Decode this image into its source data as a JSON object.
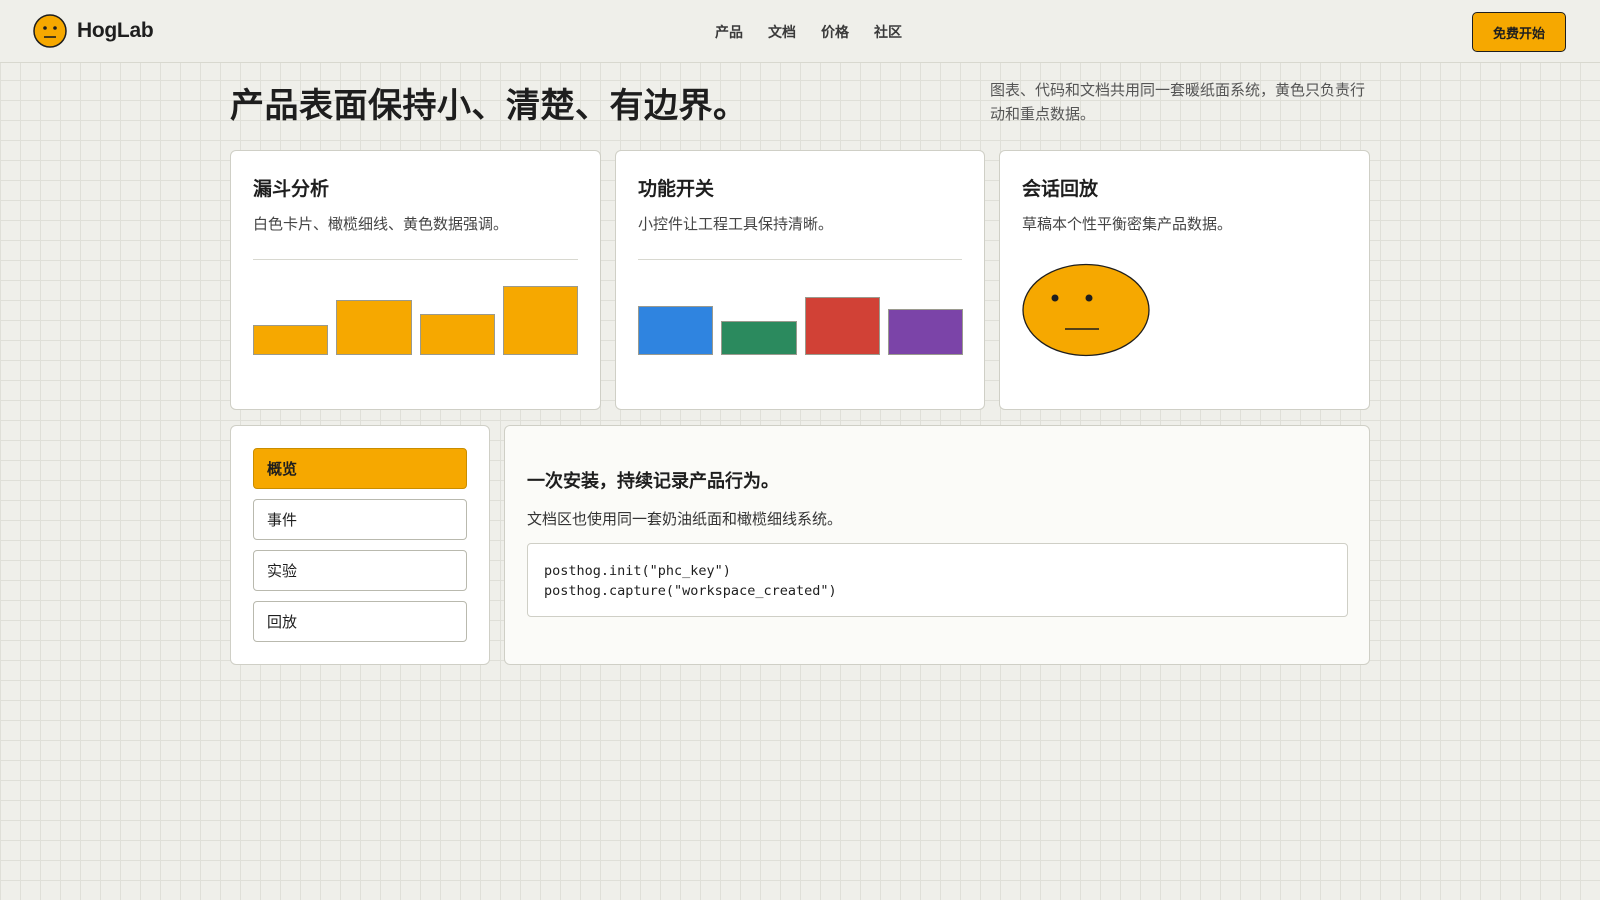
{
  "header": {
    "brand": "HogLab",
    "nav": [
      "产品",
      "文档",
      "价格",
      "社区"
    ],
    "cta": "免费开始"
  },
  "hero": {
    "headline": "产品表面保持小、清楚、有边界。",
    "tagline": "图表、代码和文档共用同一套暖纸面系统，黄色只负责行动和重点数据。"
  },
  "cards": [
    {
      "title": "漏斗分析",
      "subtitle": "白色卡片、橄榄细线、黄色数据强调。",
      "bars": [
        {
          "value": 30,
          "color": "#f6a800"
        },
        {
          "value": 56,
          "color": "#f6a800"
        },
        {
          "value": 42,
          "color": "#f6a800"
        },
        {
          "value": 70,
          "color": "#f6a800"
        }
      ]
    },
    {
      "title": "功能开关",
      "subtitle": "小控件让工程工具保持清晰。",
      "bars": [
        {
          "value": 50,
          "color": "#2f84e0"
        },
        {
          "value": 34,
          "color": "#2b8a5e"
        },
        {
          "value": 59,
          "color": "#d14136"
        },
        {
          "value": 47,
          "color": "#7b44a8"
        }
      ]
    },
    {
      "title": "会话回放",
      "subtitle": "草稿本个性平衡密集产品数据。"
    }
  ],
  "sidebar": {
    "items": [
      "概览",
      "事件",
      "实验",
      "回放"
    ],
    "active": "概览"
  },
  "docs": {
    "title": "一次安装，持续记录产品行为。",
    "subtitle": "文档区也使用同一套奶油纸面和橄榄细线系统。",
    "code": [
      "posthog.init(\"phc_key\")",
      "posthog.capture(\"workspace_created\")"
    ]
  },
  "colors": {
    "accent": "#f6a800",
    "paper": "#efefea",
    "ink": "#1e1e1e"
  },
  "icons": {
    "brand": "neutral-face-icon",
    "card3": "neutral-face-blob-icon"
  }
}
